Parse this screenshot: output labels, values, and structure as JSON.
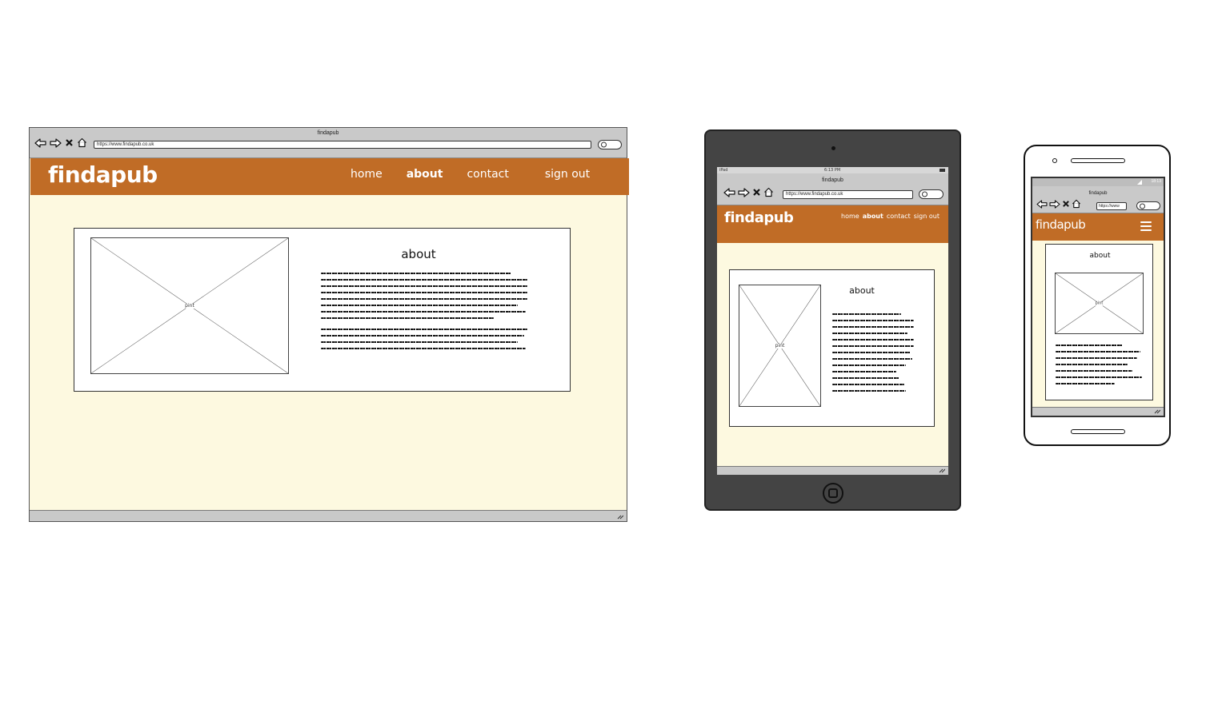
{
  "desktop": {
    "window_title": "findapub",
    "url": "https://www.findapub.co.uk",
    "brand": "findapub",
    "nav": [
      "home",
      "about",
      "contact",
      "sign out"
    ],
    "active_nav": "about",
    "card_title": "about",
    "image_label": "pint"
  },
  "tablet": {
    "status_left": "iPad",
    "status_time": "6:13 PM",
    "window_title": "findapub",
    "url": "https://www.findapub.co.uk",
    "brand": "findapub",
    "nav": [
      "home",
      "about",
      "contact",
      "sign out"
    ],
    "active_nav": "about",
    "card_title": "about",
    "image_label": "pint"
  },
  "phone": {
    "status_time": "18:13",
    "window_title": "findapub",
    "url": "https://www",
    "brand": "findapub",
    "menu_icon": "hamburger-icon",
    "card_title": "about",
    "image_label": "pint"
  },
  "colors": {
    "header": "#c06c26",
    "page_background": "#fdf9e0",
    "chrome": "#c9c9c9",
    "tablet_frame": "#444444"
  }
}
